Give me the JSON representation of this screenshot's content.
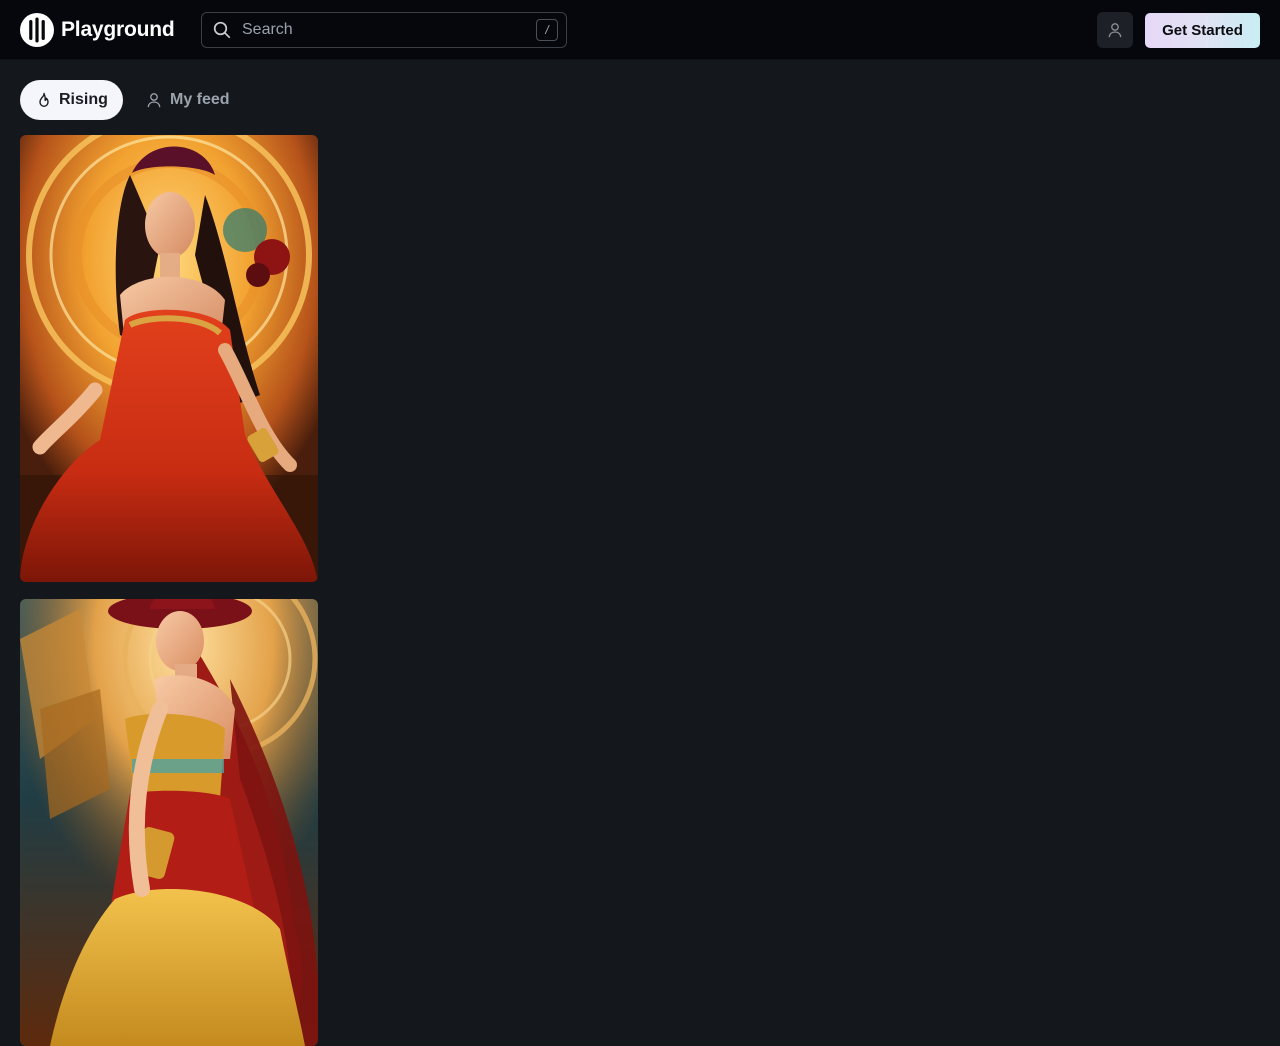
{
  "app": {
    "name": "Playground"
  },
  "search": {
    "placeholder": "Search",
    "shortcut": "/"
  },
  "header": {
    "cta_label": "Get Started",
    "user_icon": "user-icon"
  },
  "tabs": [
    {
      "label": "Rising",
      "icon": "flame-icon",
      "active": true
    },
    {
      "label": "My feed",
      "icon": "user-icon",
      "active": false
    }
  ],
  "colors": {
    "background": "#14171c",
    "topbar": "#05070c",
    "tab_active_bg": "#f4f6fb",
    "cta_gradient_start": "#e7d8f7",
    "cta_gradient_end": "#c9eef4"
  }
}
